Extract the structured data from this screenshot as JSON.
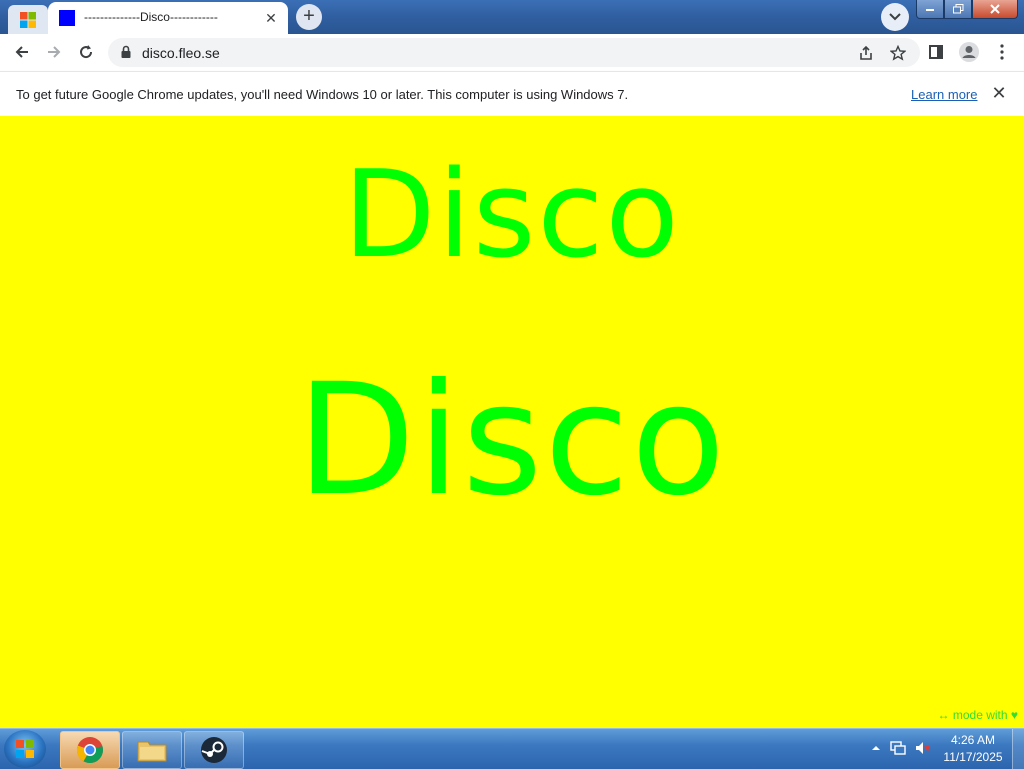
{
  "browser": {
    "tab_title": "--------------Disco------------",
    "tab_close": "✕",
    "new_tab": "+",
    "url": "disco.fleo.se"
  },
  "infobar": {
    "message": "To get future Google Chrome updates, you'll need Windows 10 or later. This computer is using Windows 7.",
    "link": "Learn more",
    "close": "✕"
  },
  "page": {
    "line1": "Disco",
    "line2": "Disco",
    "footer_note": "↔ mode with ♥",
    "background": "#ffff00",
    "text_color": "#00ff00"
  },
  "taskbar": {
    "time": "4:26 AM",
    "date": "11/17/2025",
    "apps": [
      "chrome-icon",
      "file-explorer-icon",
      "steam-icon"
    ]
  }
}
